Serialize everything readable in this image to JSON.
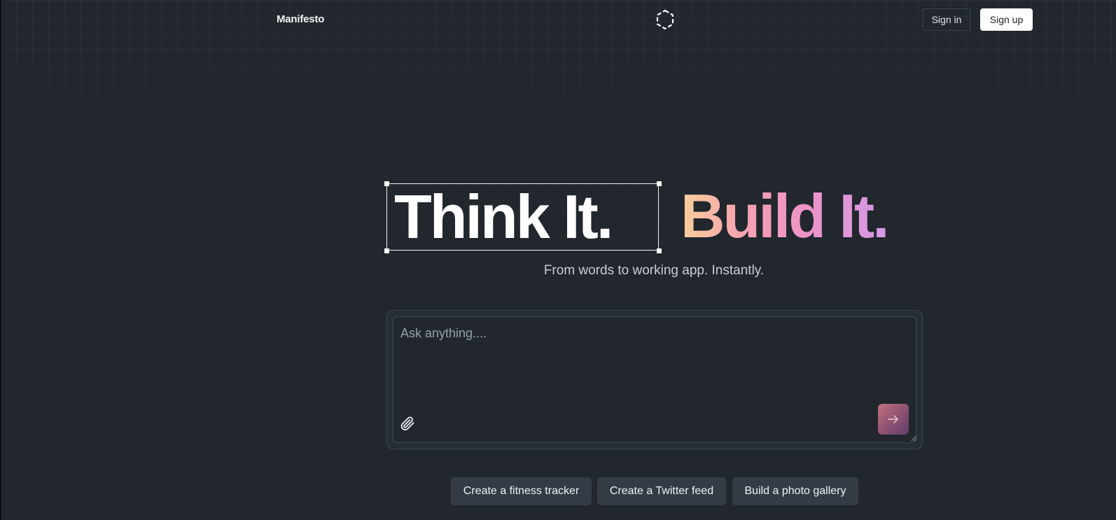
{
  "nav": {
    "brand_link": "Manifesto",
    "sign_in": "Sign in",
    "sign_up": "Sign up",
    "logo_icon": "dashed-hexagon-icon"
  },
  "hero": {
    "headline_part1": "Think It.",
    "headline_part2": "Build It.",
    "subtitle": "From words to working app. Instantly."
  },
  "prompt": {
    "placeholder": "Ask anything....",
    "value": "",
    "attach_icon": "paperclip-icon",
    "send_icon": "arrow-right-icon"
  },
  "suggestions": [
    "Create a fitness tracker",
    "Create a Twitter feed",
    "Build a photo gallery"
  ],
  "colors": {
    "background": "#21272d",
    "gradient": [
      "#f9cf9a",
      "#f6a2b1",
      "#ee93c7",
      "#d39ae8"
    ],
    "send_button": [
      "#c4727d",
      "#5d3f6b"
    ]
  }
}
